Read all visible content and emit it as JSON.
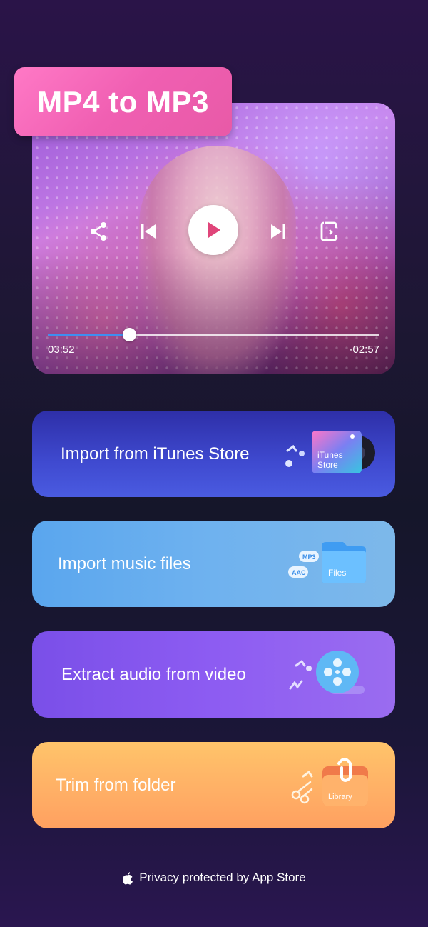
{
  "hero": {
    "title": "MP4 to MP3",
    "time_elapsed": "03:52",
    "time_remaining": "-02:57",
    "progress_fraction": 0.245
  },
  "actions": [
    {
      "label": "Import from iTunes Store",
      "icon": "itunes-store-icon",
      "icon_text_1": "iTunes",
      "icon_text_2": "Store"
    },
    {
      "label": "Import music files",
      "icon": "files-icon",
      "icon_text": "Files",
      "tag_1": "MP3",
      "tag_2": "AAC"
    },
    {
      "label": "Extract audio from video",
      "icon": "film-reel-icon"
    },
    {
      "label": "Trim from folder",
      "icon": "library-icon",
      "icon_text": "Library"
    }
  ],
  "footer": {
    "text": "Privacy protected by App Store"
  },
  "colors": {
    "accent_pink": "#f05fb2",
    "progress_blue": "#3e8ef0",
    "card_itunes": "#3f4ad0",
    "card_files": "#6fb2ef",
    "card_extract": "#8d5cf2",
    "card_trim": "#ffb066"
  }
}
